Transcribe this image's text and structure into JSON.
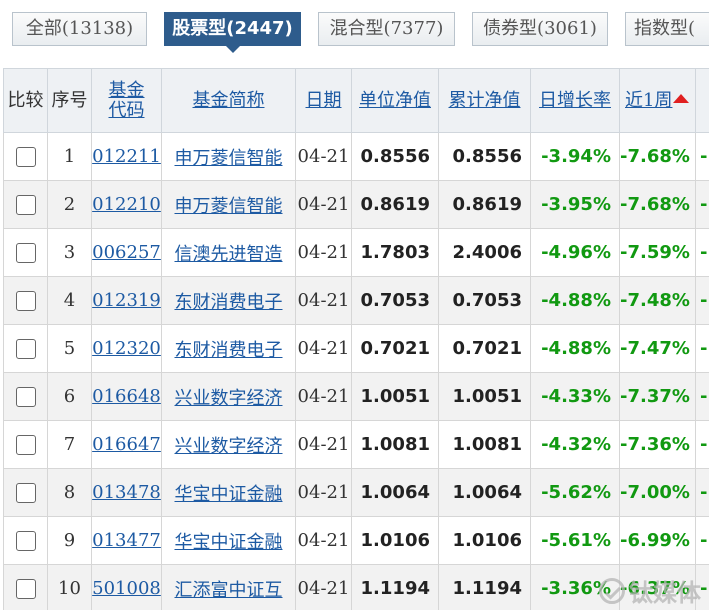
{
  "tabs": [
    {
      "label": "全部(13138)",
      "active": false
    },
    {
      "label": "股票型(2447)",
      "active": true
    },
    {
      "label": "混合型(7377)",
      "active": false
    },
    {
      "label": "债券型(3061)",
      "active": false
    },
    {
      "label": "指数型(",
      "active": false
    }
  ],
  "columns": {
    "compare": "比较",
    "index": "序号",
    "code_line1": "基金",
    "code_line2": "代码",
    "name": "基金简称",
    "date": "日期",
    "nav": "单位净值",
    "acc_nav": "累计净值",
    "daily": "日增长率",
    "week": "近1周",
    "extra": ""
  },
  "rows": [
    {
      "index": "1",
      "code": "012211",
      "name": "申万菱信智能",
      "date": "04-21",
      "nav": "0.8556",
      "acc_nav": "0.8556",
      "daily": "-3.94%",
      "week": "-7.68%",
      "extra": "-"
    },
    {
      "index": "2",
      "code": "012210",
      "name": "申万菱信智能",
      "date": "04-21",
      "nav": "0.8619",
      "acc_nav": "0.8619",
      "daily": "-3.95%",
      "week": "-7.68%",
      "extra": "-"
    },
    {
      "index": "3",
      "code": "006257",
      "name": "信澳先进智造",
      "date": "04-21",
      "nav": "1.7803",
      "acc_nav": "2.4006",
      "daily": "-4.96%",
      "week": "-7.59%",
      "extra": "-"
    },
    {
      "index": "4",
      "code": "012319",
      "name": "东财消费电子",
      "date": "04-21",
      "nav": "0.7053",
      "acc_nav": "0.7053",
      "daily": "-4.88%",
      "week": "-7.48%",
      "extra": "-"
    },
    {
      "index": "5",
      "code": "012320",
      "name": "东财消费电子",
      "date": "04-21",
      "nav": "0.7021",
      "acc_nav": "0.7021",
      "daily": "-4.88%",
      "week": "-7.47%",
      "extra": "-"
    },
    {
      "index": "6",
      "code": "016648",
      "name": "兴业数字经济",
      "date": "04-21",
      "nav": "1.0051",
      "acc_nav": "1.0051",
      "daily": "-4.33%",
      "week": "-7.37%",
      "extra": "-"
    },
    {
      "index": "7",
      "code": "016647",
      "name": "兴业数字经济",
      "date": "04-21",
      "nav": "1.0081",
      "acc_nav": "1.0081",
      "daily": "-4.32%",
      "week": "-7.36%",
      "extra": "-"
    },
    {
      "index": "8",
      "code": "013478",
      "name": "华宝中证金融",
      "date": "04-21",
      "nav": "1.0064",
      "acc_nav": "1.0064",
      "daily": "-5.62%",
      "week": "-7.00%",
      "extra": "-"
    },
    {
      "index": "9",
      "code": "013477",
      "name": "华宝中证金融",
      "date": "04-21",
      "nav": "1.0106",
      "acc_nav": "1.0106",
      "daily": "-5.61%",
      "week": "-6.99%",
      "extra": "-"
    },
    {
      "index": "10",
      "code": "501008",
      "name": "汇添富中证互",
      "date": "04-21",
      "nav": "1.1194",
      "acc_nav": "1.1194",
      "daily": "-3.36%",
      "week": "-6.37%",
      "extra": "-"
    }
  ],
  "watermark": "钛媒体",
  "colors": {
    "accent": "#2e5c8c",
    "link": "#1d5aa3",
    "negative": "#119911",
    "sort_arrow": "#e02020"
  }
}
